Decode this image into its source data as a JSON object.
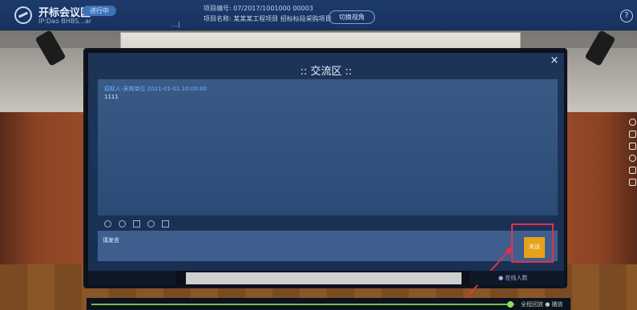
{
  "header": {
    "app_title": "开标会议区",
    "status": "进行中",
    "sub_text": "IP:Dao BHBS...ar",
    "mid_mark": "…|",
    "project_number": "项目编号: 07/2017/1001000 00003",
    "project_name": "项目名称: 某某某工程项目 招标标段采购项目",
    "switch_label": "切换视角",
    "help_glyph": "?"
  },
  "modal": {
    "title": ":: 交流区 ::",
    "close_glyph": "×",
    "messages": [
      {
        "meta": "招标人-采购单位 2021-01-01 10:00:00",
        "text": "1111"
      }
    ],
    "input_value": "请发言",
    "send_label": "发送"
  },
  "footer": {
    "right_text": "● 在线人数",
    "progress_label": "全程回放 ● 播放",
    "progress_fraction": 0.99
  },
  "colors": {
    "accent_send": "#e6a21b",
    "highlight": "#e0324a",
    "progress": "#6fc24a"
  }
}
